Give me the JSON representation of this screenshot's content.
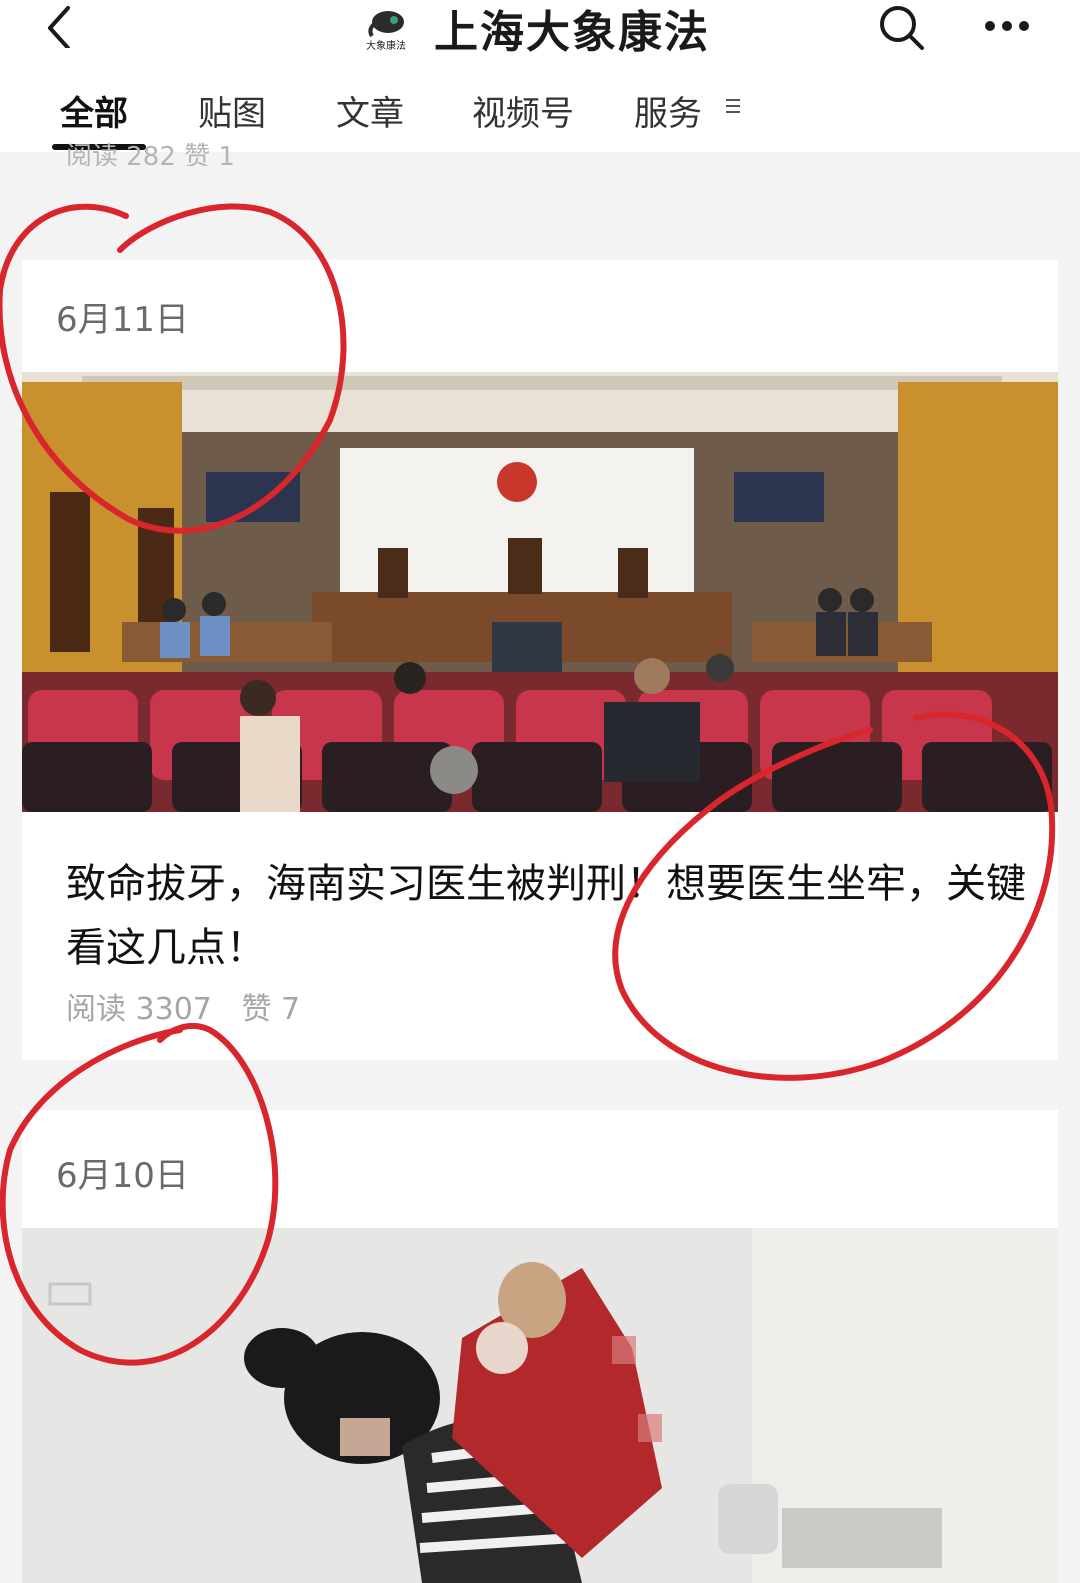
{
  "header": {
    "title": "上海大象康法",
    "logo_text": "大象康法",
    "icons": [
      "chevron-left-icon",
      "search-icon",
      "more-dots-icon"
    ]
  },
  "tabs": [
    {
      "label": "全部",
      "active": true
    },
    {
      "label": "贴图",
      "active": false
    },
    {
      "label": "文章",
      "active": false
    },
    {
      "label": "视频号",
      "active": false
    },
    {
      "label": "服务",
      "active": false
    }
  ],
  "partial_meta": "阅读 282  赞 1",
  "posts": [
    {
      "date": "6月11日",
      "title": "致命拔牙，海南实习医生被判刑！想要医生坐牢，关键看这几点！",
      "reads": "阅读 3307",
      "likes": "赞 7",
      "image": "courtroom-photo"
    },
    {
      "date": "6月10日",
      "image": "nurse-carrying-child-photo"
    }
  ],
  "colors": {
    "annotation_red": "#d8262c",
    "background": "#f3f3f3",
    "card": "#ffffff",
    "text_meta": "#a6a6a6"
  }
}
